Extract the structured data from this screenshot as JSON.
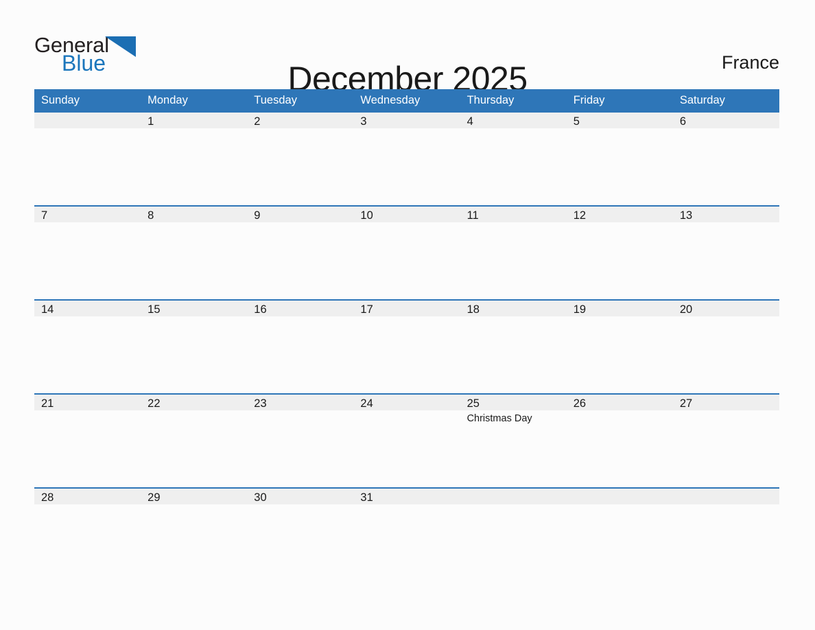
{
  "brand": {
    "logo_text_primary": "General",
    "logo_text_secondary": "Blue",
    "logo_triangle_color": "#1b6eb3",
    "logo_secondary_color": "#1b76bc"
  },
  "header": {
    "title": "December 2025",
    "country": "France"
  },
  "theme": {
    "header_blue": "#2e76b8",
    "row_divider_blue": "#2e76b8",
    "daynum_band_bg": "#efefef",
    "page_bg": "#fcfcfc",
    "text_color": "#1a1a1a"
  },
  "calendar": {
    "weekday_headers": [
      "Sunday",
      "Monday",
      "Tuesday",
      "Wednesday",
      "Thursday",
      "Friday",
      "Saturday"
    ],
    "weeks": [
      [
        {
          "day": "",
          "events": []
        },
        {
          "day": "1",
          "events": []
        },
        {
          "day": "2",
          "events": []
        },
        {
          "day": "3",
          "events": []
        },
        {
          "day": "4",
          "events": []
        },
        {
          "day": "5",
          "events": []
        },
        {
          "day": "6",
          "events": []
        }
      ],
      [
        {
          "day": "7",
          "events": []
        },
        {
          "day": "8",
          "events": []
        },
        {
          "day": "9",
          "events": []
        },
        {
          "day": "10",
          "events": []
        },
        {
          "day": "11",
          "events": []
        },
        {
          "day": "12",
          "events": []
        },
        {
          "day": "13",
          "events": []
        }
      ],
      [
        {
          "day": "14",
          "events": []
        },
        {
          "day": "15",
          "events": []
        },
        {
          "day": "16",
          "events": []
        },
        {
          "day": "17",
          "events": []
        },
        {
          "day": "18",
          "events": []
        },
        {
          "day": "19",
          "events": []
        },
        {
          "day": "20",
          "events": []
        }
      ],
      [
        {
          "day": "21",
          "events": []
        },
        {
          "day": "22",
          "events": []
        },
        {
          "day": "23",
          "events": []
        },
        {
          "day": "24",
          "events": []
        },
        {
          "day": "25",
          "events": [
            "Christmas Day"
          ]
        },
        {
          "day": "26",
          "events": []
        },
        {
          "day": "27",
          "events": []
        }
      ],
      [
        {
          "day": "28",
          "events": []
        },
        {
          "day": "29",
          "events": []
        },
        {
          "day": "30",
          "events": []
        },
        {
          "day": "31",
          "events": []
        },
        {
          "day": "",
          "events": []
        },
        {
          "day": "",
          "events": []
        },
        {
          "day": "",
          "events": []
        }
      ]
    ]
  }
}
